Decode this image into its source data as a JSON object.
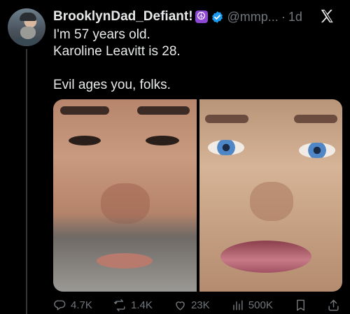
{
  "author": {
    "name": "BrooklynDad_Defiant!",
    "emoji_icon": "peace-symbol-icon",
    "verified_icon": "verified-badge-icon",
    "handle": "@mmp...",
    "separator": "·",
    "time": "1d"
  },
  "tweet": {
    "lines": [
      "I'm 57 years old.",
      "Karoline Leavitt is 28.",
      "Evil ages you, folks."
    ]
  },
  "actions": {
    "replies": "4.7K",
    "reposts": "1.4K",
    "likes": "23K",
    "views": "500K"
  },
  "colors": {
    "background": "#000000",
    "text": "#e7e9ea",
    "muted": "#71767b",
    "verified": "#1d9bf0",
    "emoji_bg": "#8f48d6"
  }
}
